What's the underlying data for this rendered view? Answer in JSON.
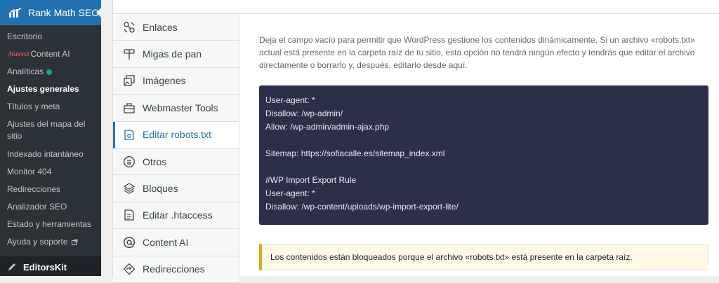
{
  "sidebar": {
    "title": "Rank Math SEO",
    "items": [
      {
        "label": "Escritorio"
      },
      {
        "label": "Content AI",
        "new_badge": "¡Nuevo!"
      },
      {
        "label": "Analíticas"
      },
      {
        "label": "Ajustes generales"
      },
      {
        "label": "Títulos y meta"
      },
      {
        "label": "Ajustes del mapa del sitio"
      },
      {
        "label": "Indexado intantáneo"
      },
      {
        "label": "Monitor 404"
      },
      {
        "label": "Redirecciones"
      },
      {
        "label": "Analizador SEO"
      },
      {
        "label": "Estado y herramientas"
      },
      {
        "label": "Ayuda y soporte"
      }
    ],
    "next_menu": "EditorsKit"
  },
  "tabs": [
    {
      "label": "Enlaces",
      "icon": "links-icon"
    },
    {
      "label": "Migas de pan",
      "icon": "signpost-icon"
    },
    {
      "label": "Imágenes",
      "icon": "images-icon"
    },
    {
      "label": "Webmaster Tools",
      "icon": "briefcase-icon"
    },
    {
      "label": "Editar robots.txt",
      "icon": "robot-icon"
    },
    {
      "label": "Otros",
      "icon": "list-icon"
    },
    {
      "label": "Bloques",
      "icon": "blocks-icon"
    },
    {
      "label": "Editar .htaccess",
      "icon": "file-icon"
    },
    {
      "label": "Content AI",
      "icon": "at-icon"
    },
    {
      "label": "Redirecciones",
      "icon": "redirect-icon"
    }
  ],
  "main": {
    "description": "Deja el campo vacío para permitir que WordPress gestione los contenidos dinámicamente. Si un archivo «robots.txt» actual está presente en la carpeta raíz de tu sitio, esta opción no tendrá ningún efecto y tendrás que editar el archivo directamente o borrarlo y, después, editarlo desde aquí.",
    "robots_content": "User-agent: *\nDisallow: /wp-admin/\nAllow: /wp-admin/admin-ajax.php\n\nSitemap: https://sofiacalle.es/sitemap_index.xml\n\n#WP Import Export Rule\nUser-agent: *\nDisallow: /wp-content/uploads/wp-import-export-lite/",
    "notice": "Los contenidos están bloqueados porque el archivo «robots.txt» está presente en la carpeta raíz."
  },
  "colors": {
    "accent": "#2271b1",
    "sidebar_bg": "#1d2327",
    "code_bg": "#2c2f48",
    "notice_border": "#dba617",
    "status_dot": "#10ac84"
  }
}
